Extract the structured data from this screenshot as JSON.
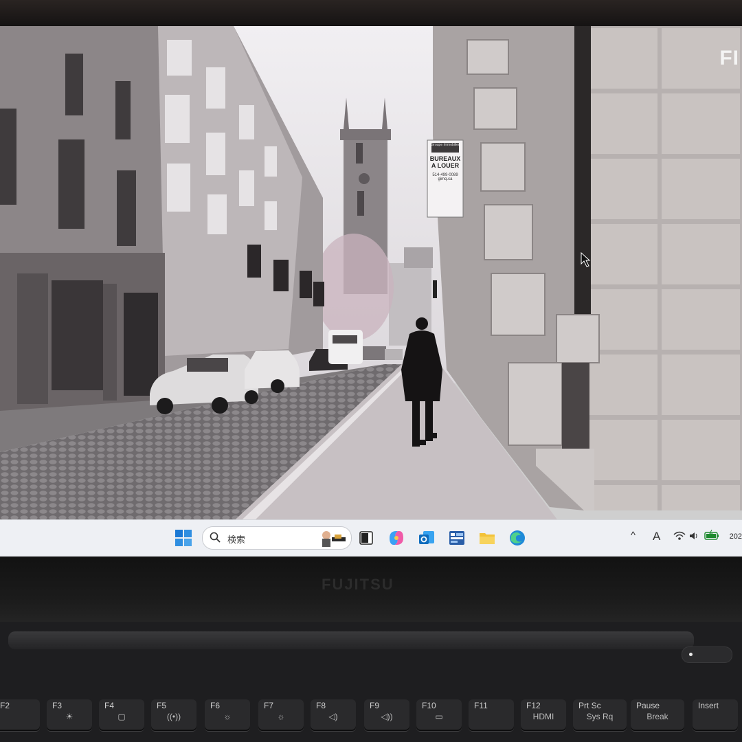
{
  "screen": {
    "banner_sign": {
      "line1": "BUREAUX",
      "line2": "A LOUER",
      "phone": "514-499-0089",
      "site": "gimq.ca",
      "small": "Groupe Immobilier"
    },
    "watermark": "FI"
  },
  "taskbar": {
    "search_placeholder": "検索",
    "apps": [
      {
        "name": "start-icon"
      },
      {
        "name": "task-view-icon"
      },
      {
        "name": "copilot-icon"
      },
      {
        "name": "outlook-icon"
      },
      {
        "name": "control-panel-icon"
      },
      {
        "name": "file-explorer-icon"
      },
      {
        "name": "edge-icon"
      }
    ],
    "tray": {
      "chevron": "^",
      "ime": "A",
      "clock": "202"
    }
  },
  "laptop": {
    "brand": "FUJITSU",
    "keys": [
      {
        "label": "F2",
        "sub": ""
      },
      {
        "label": "F3",
        "sub": "☀"
      },
      {
        "label": "F4",
        "sub": "▢"
      },
      {
        "label": "F5",
        "sub": "((•))"
      },
      {
        "label": "F6",
        "sub": "☼"
      },
      {
        "label": "F7",
        "sub": "☼"
      },
      {
        "label": "F8",
        "sub": "◁)"
      },
      {
        "label": "F9",
        "sub": "◁))"
      },
      {
        "label": "F10",
        "sub": "▭"
      },
      {
        "label": "F11",
        "sub": ""
      },
      {
        "label": "F12",
        "sub": "HDMI"
      },
      {
        "label": "Prt Sc",
        "sub": "Sys Rq"
      },
      {
        "label": "Pause",
        "sub": "Break"
      },
      {
        "label": "Insert",
        "sub": ""
      }
    ]
  },
  "colors": {
    "taskbar": "#eef0f4",
    "bezel": "#141414",
    "start_blue": "#1a78d4",
    "folder": "#f3c238"
  }
}
